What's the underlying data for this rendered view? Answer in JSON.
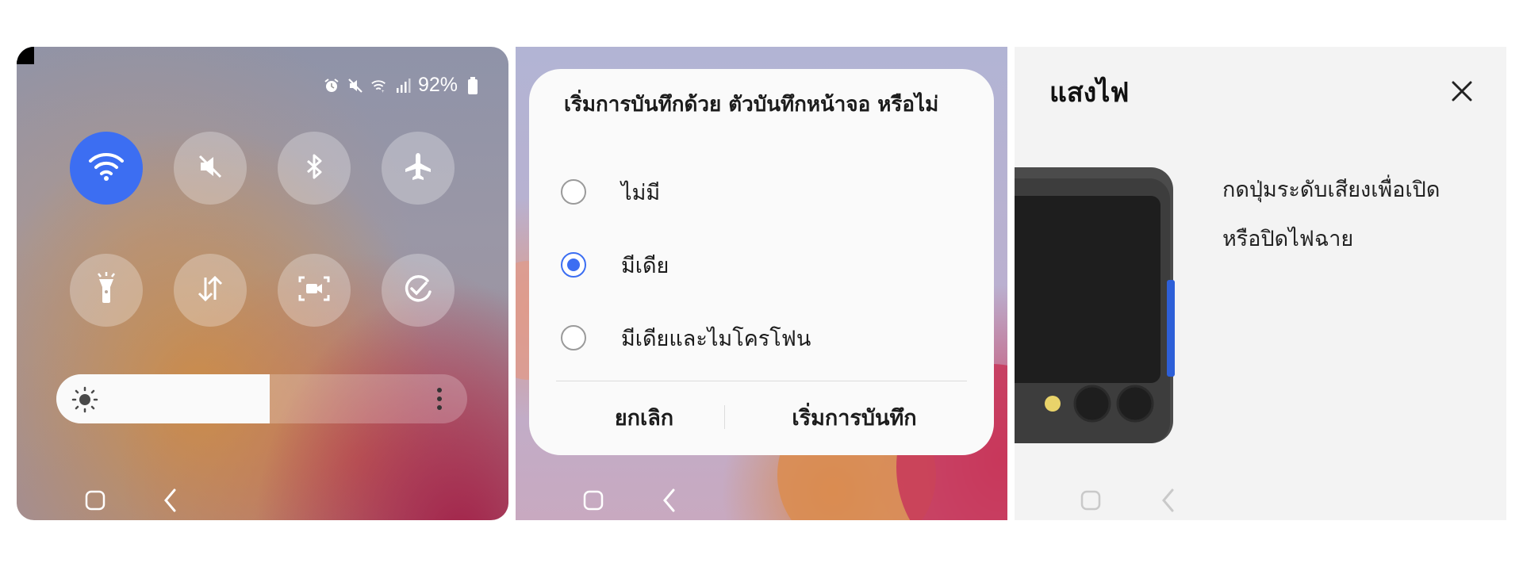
{
  "colors": {
    "accent": "#3c6ef2"
  },
  "quick_panel": {
    "status": {
      "icons": [
        "alarm-icon",
        "mute-icon",
        "wifi-calling-icon",
        "signal-icon",
        "battery-icon"
      ],
      "battery_text": "92%"
    },
    "tiles": [
      {
        "name": "wifi",
        "icon": "wifi-icon",
        "active": true
      },
      {
        "name": "sound",
        "icon": "mute-icon",
        "active": false
      },
      {
        "name": "bluetooth",
        "icon": "bluetooth-icon",
        "active": false
      },
      {
        "name": "airplane",
        "icon": "airplane-icon",
        "active": false
      },
      {
        "name": "flashlight",
        "icon": "flashlight-icon",
        "active": false
      },
      {
        "name": "mobile-data",
        "icon": "data-arrows-icon",
        "active": false
      },
      {
        "name": "screen-recorder",
        "icon": "screen-record-icon",
        "active": false
      },
      {
        "name": "auto-rotate",
        "icon": "sync-check-icon",
        "active": false
      }
    ],
    "brightness": {
      "level": 0.52,
      "icon": "sun-icon",
      "menu_icon": "more-vertical-icon"
    },
    "nav": {
      "home_icon": "home-square-icon",
      "back_icon": "back-chevron-icon"
    }
  },
  "dialog": {
    "title": "เริ่มการบันทึกด้วย ตัวบันทึกหน้าจอ หรือไม่",
    "options": [
      {
        "label": "ไม่มี",
        "selected": false
      },
      {
        "label": "มีเดีย",
        "selected": true
      },
      {
        "label": "มีเดียและไมโครโฟน",
        "selected": false
      }
    ],
    "cancel_label": "ยกเลิก",
    "confirm_label": "เริ่มการบันทึก"
  },
  "flashlight_help": {
    "title": "แสงไฟ",
    "close_icon": "close-icon",
    "description_line1": "กดปุ่มระดับเสียงเพื่อเปิด",
    "description_line2": "หรือปิดไฟฉาย",
    "illustration": "phone-camera-volume-key-illustration"
  }
}
